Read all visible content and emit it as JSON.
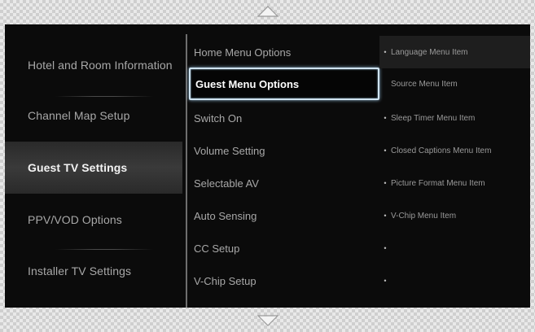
{
  "nav": {
    "up_arrow": "up-arrow-icon",
    "down_arrow": "down-arrow-icon"
  },
  "categories": [
    {
      "label": "Hotel and Room Information"
    },
    {
      "label": "Channel Map Setup"
    },
    {
      "label": "Guest TV Settings",
      "selected": true
    },
    {
      "label": "PPV/VOD Options"
    },
    {
      "label": "Installer TV Settings"
    }
  ],
  "guest_settings": [
    {
      "label": "Home Menu Options"
    },
    {
      "label": "Guest Menu Options",
      "focused": true
    },
    {
      "label": "Switch On"
    },
    {
      "label": "Volume Setting"
    },
    {
      "label": "Selectable AV"
    },
    {
      "label": "Auto Sensing"
    },
    {
      "label": "CC Setup"
    },
    {
      "label": "V-Chip Setup"
    }
  ],
  "guest_menu_items": [
    {
      "label": "Language Menu Item",
      "bullet": "•"
    },
    {
      "label": "Source Menu Item",
      "bullet": ""
    },
    {
      "label": "Sleep Timer Menu Item",
      "bullet": "•"
    },
    {
      "label": "Closed Captions Menu Item",
      "bullet": "•"
    },
    {
      "label": "Picture Format Menu Item",
      "bullet": "•"
    },
    {
      "label": "V-Chip Menu Item",
      "bullet": "•"
    },
    {
      "label": "",
      "bullet": "•"
    },
    {
      "label": "",
      "bullet": "•"
    }
  ],
  "colors": {
    "background": "#0b0b0b",
    "focus_border": "#cfe3f0",
    "selected_bg": "#333333",
    "text": "#a8a8a8"
  }
}
